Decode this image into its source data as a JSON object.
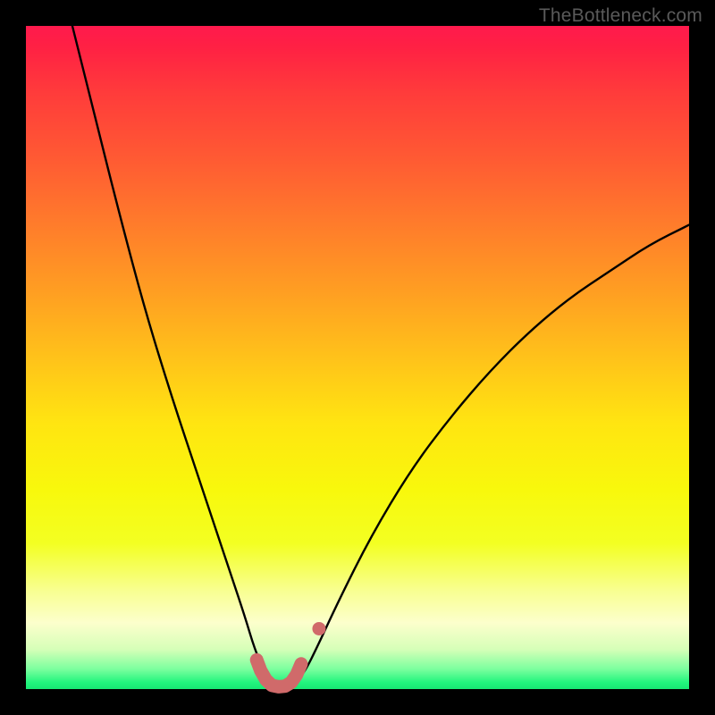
{
  "watermark": {
    "text": "TheBottleneck.com"
  },
  "colors": {
    "frame_bg_top": "#ff1a4d",
    "frame_bg_bottom": "#18e873",
    "curve_stroke": "#000000",
    "marker_fill": "#d06a6a",
    "marker_stroke": "#d06a6a",
    "page_bg": "#000000"
  },
  "chart_data": {
    "type": "line",
    "title": "",
    "xlabel": "",
    "ylabel": "",
    "xlim": [
      0,
      100
    ],
    "ylim": [
      0,
      100
    ],
    "grid": false,
    "legend": false,
    "series": [
      {
        "name": "bottleneck-curve",
        "x": [
          7,
          10,
          14,
          18,
          22,
          26,
          29,
          31,
          33,
          34.5,
          36,
          37,
          38,
          39,
          40.5,
          42,
          44,
          47,
          52,
          58,
          64,
          70,
          76,
          82,
          88,
          94,
          100
        ],
        "y": [
          100,
          88,
          72,
          57,
          44,
          32,
          23,
          17,
          11,
          6,
          2.5,
          0.8,
          0.3,
          0.3,
          0.9,
          2.5,
          6.5,
          13,
          23,
          33,
          41,
          48,
          54,
          59,
          63,
          67,
          70
        ]
      }
    ],
    "markers": {
      "name": "trough-markers",
      "style": "line-with-endcaps",
      "points_x": [
        34.8,
        35.4,
        36.2,
        37.1,
        38.1,
        39.1,
        40.0,
        40.8,
        41.5
      ],
      "points_y": [
        4.4,
        2.8,
        1.4,
        0.55,
        0.35,
        0.45,
        1.0,
        2.15,
        3.8
      ],
      "dot": {
        "x": 44.2,
        "y": 9.1
      }
    }
  }
}
